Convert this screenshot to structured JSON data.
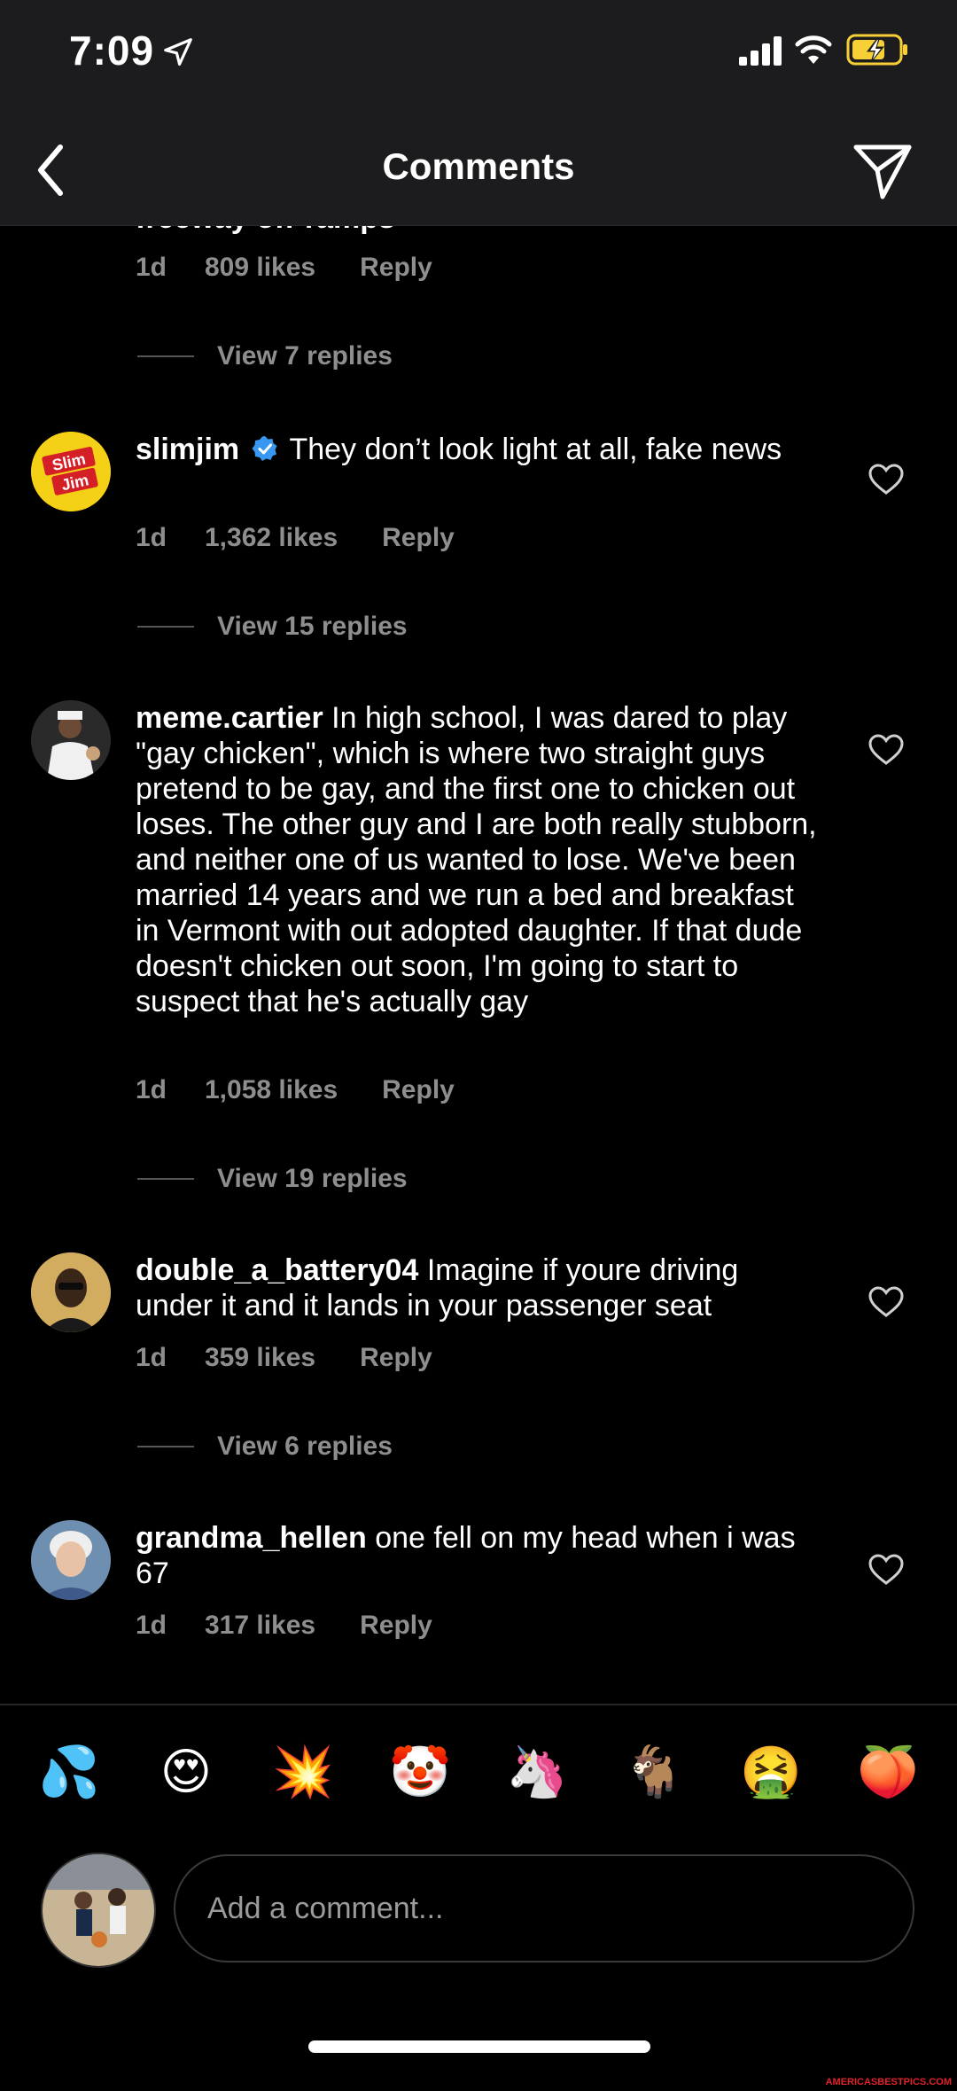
{
  "status_bar": {
    "time": "7:09"
  },
  "header": {
    "title": "Comments"
  },
  "partial_comment": {
    "text_fragment": "freeway off-ramps",
    "time": "1d",
    "likes": "809 likes",
    "reply": "Reply",
    "view_replies": "View 7 replies"
  },
  "comments": [
    {
      "username": "slimjim",
      "text": "They don’t look light at all, fake news",
      "time": "1d",
      "likes": "1,362 likes",
      "reply": "Reply",
      "view_replies": "View 15 replies",
      "avatar_text": "Slim Jim"
    },
    {
      "username": "meme.cartier",
      "text": "In high school, I was dared to play \"gay chicken\", which is where two straight guys pretend to be gay, and the first one to chicken out loses. The other guy and I are both really stubborn, and neither one of us wanted to lose. We've been married 14 years and we run a bed and breakfast in Vermont with out adopted daughter. If that dude doesn't chicken out soon, I'm going to start to suspect that he's actually gay",
      "time": "1d",
      "likes": "1,058 likes",
      "reply": "Reply",
      "view_replies": "View 19 replies"
    },
    {
      "username": "double_a_battery04",
      "text": "Imagine if youre driving under it and it lands in your passenger seat",
      "time": "1d",
      "likes": "359 likes",
      "reply": "Reply",
      "view_replies": "View 6 replies"
    },
    {
      "username": "grandma_hellen",
      "text": "one fell on my head when i was 67",
      "time": "1d",
      "likes": "317 likes",
      "reply": "Reply"
    }
  ],
  "emoji_bar": [
    "💦",
    "😍",
    "💥",
    "🤡",
    "🦄",
    "🐐",
    "🤮",
    "🍑"
  ],
  "composer": {
    "placeholder": "Add a comment..."
  },
  "watermark": "AMERICASBESTPICS.COM",
  "colors": {
    "background": "#000000",
    "header": "#1c1c1e",
    "meta": "#8e8e8e",
    "verified": "#3897f0",
    "battery": "#f7d038"
  }
}
